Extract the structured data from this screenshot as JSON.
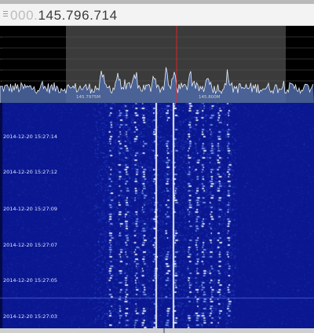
{
  "frequency": {
    "prefix": "000.",
    "value": "145.796.714"
  },
  "spectrum": {
    "x_labels": [
      "145.7975M",
      "145.800M"
    ],
    "accent_color": "#6f8fc9",
    "center_marker_color": "#ff2020"
  },
  "waterfall": {
    "timestamps": [
      "2014-12-20 15:27:14",
      "2014-12-20 15:27:12",
      "2014-12-20 15:27:09",
      "2014-12-20 15:27:07",
      "2014-12-20 15:27:05",
      "2014-12-20 15:27:03"
    ],
    "background_color": "#0c1a9a"
  }
}
